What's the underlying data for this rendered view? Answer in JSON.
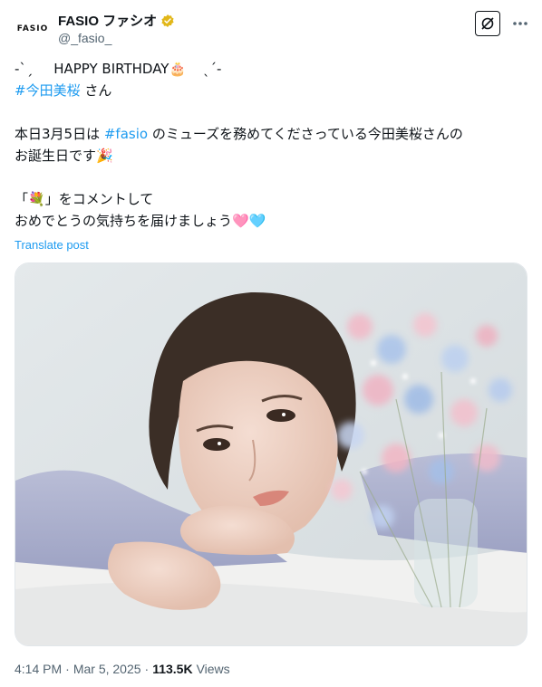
{
  "header": {
    "avatar_text": "FASIO",
    "display_name": "FASIO ファシオ",
    "handle": "@_fasio_",
    "verified_icon": "verified-badge-gold"
  },
  "post": {
    "line1_prefix": "-ˋˏ",
    "line1_text": "HAPPY BIRTHDAY",
    "line1_emoji": "🎂",
    "line1_suffix": "ˎˊ-",
    "line2_hashtag": "#今田美桜",
    "line2_text": " さん",
    "line3_a": "本日3月5日は ",
    "line3_hashtag": "#fasio",
    "line3_b": " のミューズを務めてくださっている今田美桜さんの",
    "line4_text": "お誕生日です",
    "line4_emoji": "🎉",
    "line5_a": "「",
    "line5_emoji": "💐",
    "line5_b": "」をコメントして",
    "line6_text": "おめでとうの気持ちを届けましょう",
    "line6_emoji": "🩷🩵",
    "translate": "Translate post"
  },
  "meta": {
    "time": "4:14 PM",
    "sep": "·",
    "date": "Mar 5, 2025",
    "views_count": "113.5K",
    "views_label": "Views"
  }
}
